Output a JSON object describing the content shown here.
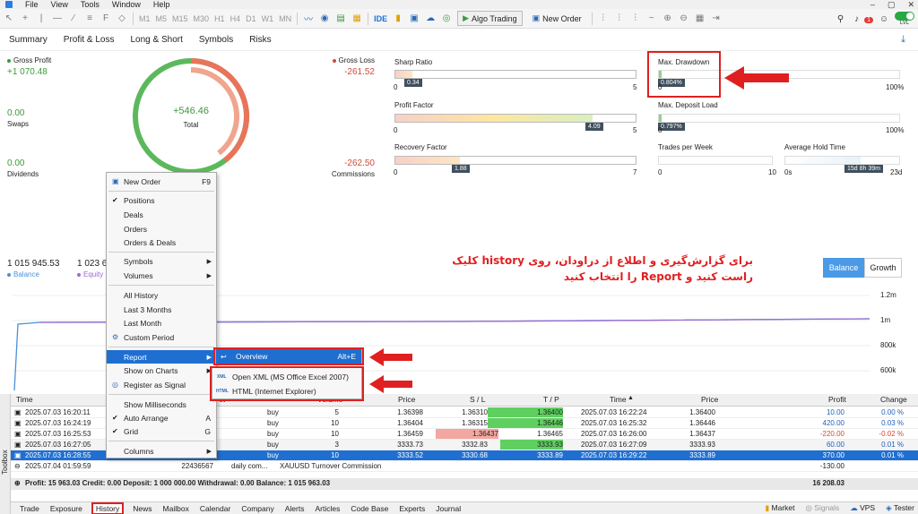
{
  "menu": [
    "File",
    "View",
    "Tools",
    "Window",
    "Help"
  ],
  "toolbar": {
    "timeframes": [
      "M1",
      "M5",
      "M15",
      "M30",
      "H1",
      "H4",
      "D1",
      "W1",
      "MN"
    ],
    "ide": "IDE",
    "algo_trading": "Algo Trading",
    "new_order": "New Order",
    "notif_count": "1",
    "lvl": "LVL"
  },
  "report_tabs": [
    "Summary",
    "Profit & Loss",
    "Long & Short",
    "Symbols",
    "Risks"
  ],
  "stats": {
    "gross_profit_label": "Gross Profit",
    "gross_profit": "+1 070.48",
    "gross_loss_label": "Gross Loss",
    "gross_loss": "-261.52",
    "swaps_value": "0.00",
    "swaps_label": "Swaps",
    "dividends_value": "0.00",
    "dividends_label": "Dividends",
    "commissions_value": "-262.50",
    "commissions_label": "Commissions",
    "total_value": "+546.46",
    "total_label": "Total"
  },
  "metrics": {
    "sharp_ratio": {
      "label": "Sharp Ratio",
      "tag": "0.34",
      "min": "0",
      "max": "5"
    },
    "profit_factor": {
      "label": "Profit Factor",
      "tag": "4.09",
      "min": "0",
      "max": "5"
    },
    "recovery_factor": {
      "label": "Recovery Factor",
      "tag": "1.88",
      "min": "0",
      "max": "7"
    },
    "max_drawdown": {
      "label": "Max. Drawdown",
      "tag": "0.804%",
      "min": "0",
      "max": "100%"
    },
    "max_deposit_load": {
      "label": "Max. Deposit Load",
      "tag": "0.797%",
      "min": "0",
      "max": "100%"
    },
    "trades_per_week": {
      "label": "Trades per Week",
      "min": "0",
      "max": "10"
    },
    "avg_hold_time": {
      "label": "Average Hold Time",
      "tag": "15d 8h 39m",
      "min": "0s",
      "max": "23d"
    }
  },
  "balance_area": {
    "balance_value": "1 015 945.53",
    "balance_label": "Balance",
    "equity_value": "1 023 6",
    "equity_label": "Equity",
    "btn_balance": "Balance",
    "btn_growth": "Growth",
    "y_ticks": [
      "1.2m",
      "1m",
      "800k",
      "600k"
    ]
  },
  "annotation": {
    "line1": "برای گزارش‌گیری و اطلاع از دراودان، روی history کلیک",
    "line2": "راست کنید و Report را انتخاب کنید"
  },
  "context_menu": {
    "new_order": "New Order",
    "new_order_shortcut": "F9",
    "positions": "Positions",
    "deals": "Deals",
    "orders": "Orders",
    "orders_deals": "Orders & Deals",
    "symbols": "Symbols",
    "volumes": "Volumes",
    "all_history": "All History",
    "last_3_months": "Last 3 Months",
    "last_month": "Last Month",
    "custom_period": "Custom Period",
    "report": "Report",
    "show_on_charts": "Show on Charts",
    "register_signal": "Register as Signal",
    "show_ms": "Show Milliseconds",
    "auto_arrange": "Auto Arrange",
    "auto_arrange_sc": "A",
    "grid": "Grid",
    "grid_sc": "G",
    "columns": "Columns"
  },
  "report_submenu": {
    "overview": "Overview",
    "overview_sc": "Alt+E",
    "xml_tag": "XML",
    "open_xml": "Open XML (MS Office Excel 2007)",
    "html_tag": "HTML",
    "html": "HTML (Internet Explorer)"
  },
  "table": {
    "headers": [
      "Time",
      "et",
      "Volume",
      "Price",
      "S / L",
      "T / P",
      "Time",
      "Price",
      "Profit",
      "Change"
    ],
    "rows": [
      {
        "time": "2025.07.03 16:20:11",
        "id": "11",
        "type": "buy",
        "volume": "5",
        "price": "1.36398",
        "sl": "1.36310",
        "tp": "1.36400",
        "time2": "2025.07.03 16:22:24",
        "price2": "1.36400",
        "profit": "10.00",
        "change": "0.00 %"
      },
      {
        "time": "2025.07.03 16:24:19",
        "id": "64",
        "type": "buy",
        "volume": "10",
        "price": "1.36404",
        "sl": "1.36315",
        "tp": "1.36446",
        "time2": "2025.07.03 16:25:32",
        "price2": "1.36446",
        "profit": "420.00",
        "change": "0.03 %"
      },
      {
        "time": "2025.07.03 16:25:53",
        "id": "74",
        "type": "buy",
        "volume": "10",
        "price": "1.36459",
        "sl": "1.36437",
        "tp": "1.36465",
        "time2": "2025.07.03 16:26:00",
        "price2": "1.36437",
        "profit": "-220.00",
        "change": "-0.02 %"
      },
      {
        "time": "2025.07.03 16:27:05",
        "id": "88",
        "type": "buy",
        "volume": "3",
        "price": "3333.73",
        "sl": "3332.83",
        "tp": "3333.93",
        "time2": "2025.07.03 16:27:09",
        "price2": "3333.93",
        "profit": "60.00",
        "change": "0.01 %"
      },
      {
        "time": "2025.07.03 16:28:55",
        "symbol": "xauusd",
        "id": "27671677",
        "type": "buy",
        "volume": "10",
        "price": "3333.52",
        "sl": "3330.68",
        "tp": "3333.89",
        "time2": "2025.07.03 16:29:22",
        "price2": "3333.89",
        "profit": "370.00",
        "change": "0.01 %"
      }
    ],
    "commission_row": {
      "time": "2025.07.04 01:59:59",
      "id": "22436567",
      "type": "daily com...",
      "desc": "XAUUSD Turnover Commission",
      "profit": "-130.00"
    },
    "summary": {
      "text": "Profit: 15 963.03  Credit: 0.00  Deposit: 1 000 000.00  Withdrawal: 0.00  Balance: 1 015 963.03",
      "total": "16 208.03"
    }
  },
  "bottom_tabs": [
    "Trade",
    "Exposure",
    "History",
    "News",
    "Mailbox",
    "Calendar",
    "Company",
    "Alerts",
    "Articles",
    "Code Base",
    "Experts",
    "Journal"
  ],
  "bottom_right": [
    "Market",
    "Signals",
    "VPS",
    "Tester"
  ],
  "toolbox": "Toolbox"
}
